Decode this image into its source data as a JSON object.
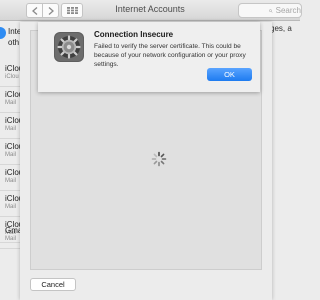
{
  "window": {
    "title": "Internet Accounts"
  },
  "search": {
    "placeholder": "Search"
  },
  "background": {
    "intro_line1": "Inte",
    "intro_line2": "oth",
    "right_text": "ges, a"
  },
  "accounts_list": [
    {
      "name": "iClou",
      "sub": "iClou"
    },
    {
      "name": "iClou",
      "sub": "Mail"
    },
    {
      "name": "iClou",
      "sub": "Mail"
    },
    {
      "name": "iClou",
      "sub": "Mail"
    },
    {
      "name": "iClou",
      "sub": "Mail"
    },
    {
      "name": "iClou",
      "sub": "Mail"
    },
    {
      "name": "iClou",
      "sub": "Mail"
    },
    {
      "name": "Gma",
      "sub": "Mail"
    }
  ],
  "sheet": {
    "cancel_label": "Cancel"
  },
  "alert": {
    "title": "Connection Insecure",
    "message": "Failed to verify the server certificate. This could be because of your network configuration or your proxy settings.",
    "ok_label": "OK"
  },
  "colors": {
    "accent": "#1e7bf0",
    "intro_dot": "#2f8cf3"
  }
}
